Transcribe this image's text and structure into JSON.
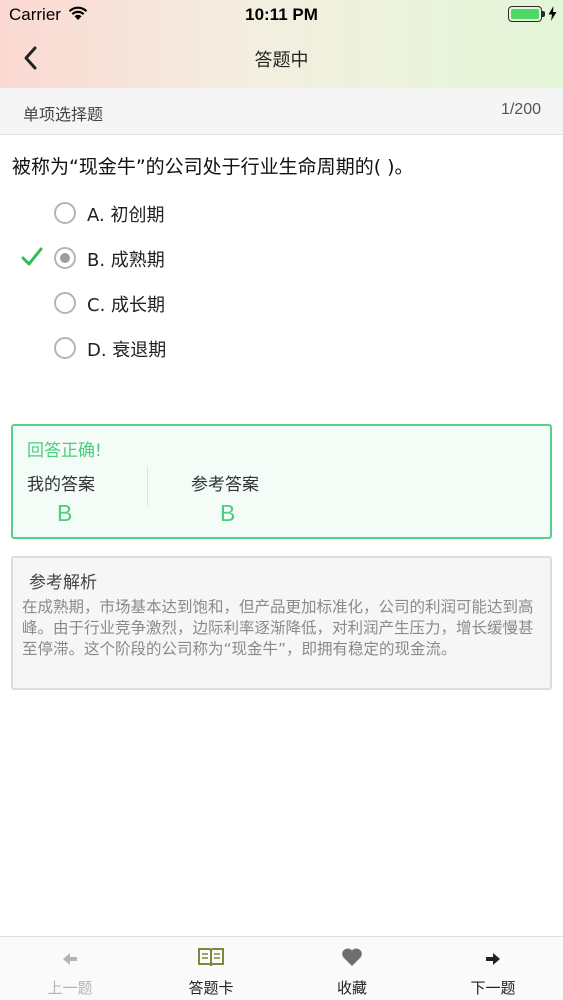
{
  "status_bar": {
    "carrier": "Carrier",
    "time": "10:11 PM"
  },
  "nav": {
    "title": "答题中"
  },
  "subbar": {
    "question_type": "单项选择题",
    "progress": "1/200"
  },
  "question": {
    "text": "被称为“现金牛”的公司处于行业生命周期的(     )。",
    "options": [
      {
        "label": "A. 初创期",
        "selected": false,
        "marked_correct": false
      },
      {
        "label": "B. 成熟期",
        "selected": true,
        "marked_correct": true
      },
      {
        "label": "C. 成长期",
        "selected": false,
        "marked_correct": false
      },
      {
        "label": "D. 衰退期",
        "selected": false,
        "marked_correct": false
      }
    ]
  },
  "result": {
    "message": "回答正确!",
    "my_answer_label": "我的答案",
    "my_answer": "B",
    "reference_label": "参考答案",
    "reference_answer": "B"
  },
  "analysis": {
    "title": "参考解析",
    "body": "在成熟期，市场基本达到饱和，但产品更加标准化，公司的利润可能达到高峰。由于行业竞争激烈，边际利率逐渐降低，对利润产生压力，增长缓慢甚至停滞。这个阶段的公司称为“现金牛”，即拥有稳定的现金流。"
  },
  "tabbar": {
    "prev": {
      "label": "上一题",
      "icon": "arrow-left-icon",
      "enabled": false
    },
    "card": {
      "label": "答题卡",
      "icon": "book-icon",
      "enabled": true
    },
    "favorite": {
      "label": "收藏",
      "icon": "heart-icon",
      "enabled": true
    },
    "next": {
      "label": "下一题",
      "icon": "arrow-right-icon",
      "enabled": true
    }
  },
  "colors": {
    "correct": "#4ccc7e",
    "card_icon": "#7a8a3a",
    "battery": "#4cd964"
  }
}
